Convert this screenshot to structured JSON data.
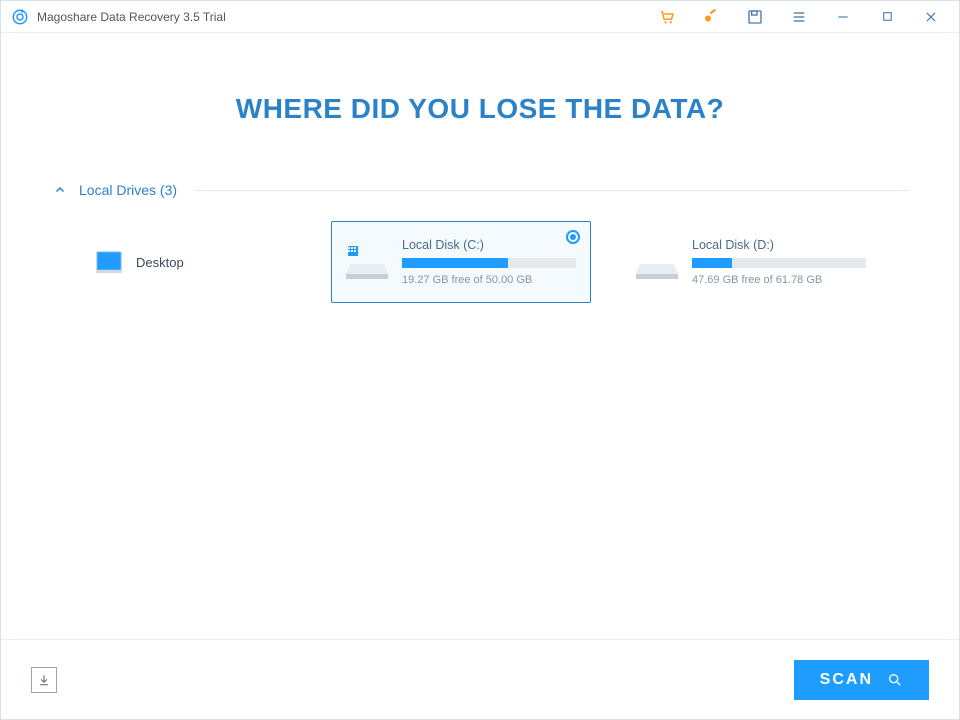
{
  "app": {
    "title": "Magoshare Data Recovery 3.5 Trial"
  },
  "colors": {
    "accent": "#1e9cff",
    "heading": "#2c82c9"
  },
  "main": {
    "headline": "WHERE DID YOU LOSE THE DATA?"
  },
  "section": {
    "title_base": "Local Drives",
    "count": 3,
    "title": "Local Drives (3)"
  },
  "drives": [
    {
      "id": "desktop",
      "type": "desktop",
      "label": "Desktop",
      "selected": false
    },
    {
      "id": "c",
      "type": "system",
      "label": "Local Disk (C:)",
      "free_gb": 19.27,
      "total_gb": 50.0,
      "used_pct": 61,
      "free_text": "19.27 GB free of 50.00 GB",
      "selected": true
    },
    {
      "id": "d",
      "type": "data",
      "label": "Local Disk (D:)",
      "free_gb": 47.69,
      "total_gb": 61.78,
      "used_pct": 23,
      "free_text": "47.69 GB free of 61.78 GB",
      "selected": false
    }
  ],
  "footer": {
    "scan_label": "SCAN"
  }
}
